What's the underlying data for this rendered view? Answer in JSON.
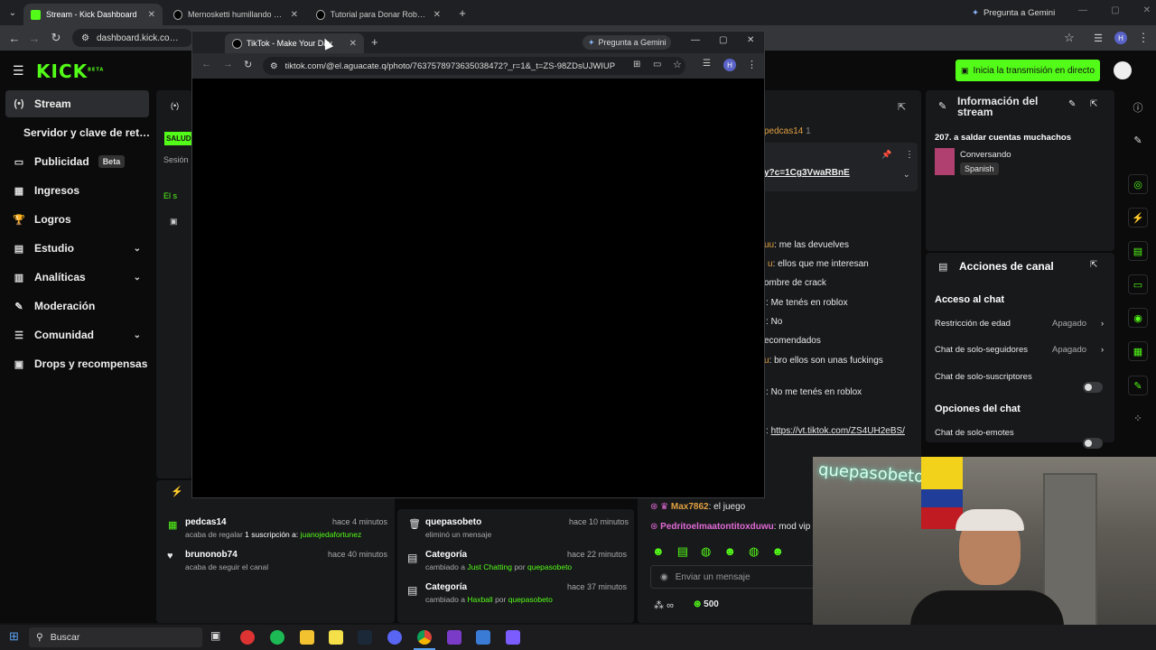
{
  "outer_tabs": [
    {
      "title": "Stream - Kick Dashboard",
      "active": true
    },
    {
      "title": "Mernosketti humillando a los T"
    },
    {
      "title": "Tutorial para Donar Robux a un"
    }
  ],
  "gemini_label": "Pregunta a Gemini",
  "outer_url": "dashboard.kick.com/strea",
  "profile_initial": "H",
  "kick": {
    "logo": "KICK",
    "logo_beta": "BETA",
    "go_live": "Inicia la transmisión en directo",
    "sidebar": [
      {
        "label": "Stream",
        "icon": "(•)"
      },
      {
        "label": "Servidor y clave de retransmisión",
        "icon": ""
      },
      {
        "label": "Publicidad",
        "icon": "▭",
        "badge": "Beta"
      },
      {
        "label": "Ingresos",
        "icon": "▦"
      },
      {
        "label": "Logros",
        "icon": "🏆"
      },
      {
        "label": "Estudio",
        "icon": "▤",
        "chev": "⌄"
      },
      {
        "label": "Analíticas",
        "icon": "▥",
        "chev": "⌄"
      },
      {
        "label": "Moderación",
        "icon": "✎"
      },
      {
        "label": "Comunidad",
        "icon": "☰",
        "chev": "⌄"
      },
      {
        "label": "Drops y recompensas",
        "icon": "▣"
      }
    ],
    "center": {
      "badge": "SALUD",
      "session": "Sesión",
      "status": "El s"
    },
    "chat": {
      "pinned_user": "pedcas14",
      "pinned_count": "1",
      "pinned_link": "y?c=1Cg3VwaRBnE",
      "lines": [
        {
          "user": "uu",
          "text": "me las devuelves"
        },
        {
          "user": "u",
          "text": "ellos que me interesan"
        },
        {
          "user": "",
          "text": "ombre de crack"
        },
        {
          "user": "",
          "text": "Me tenés en roblox"
        },
        {
          "user": "",
          "text": "No"
        },
        {
          "user": "",
          "text": "ecomendados"
        },
        {
          "user": "u",
          "text": "bro ellos son unas fuckings"
        },
        {
          "user": "",
          "text": "No me tenés en roblox"
        },
        {
          "user": "",
          "text": "https://vt.tiktok.com/ZS4UH2eBS/"
        }
      ],
      "bottom_lines": [
        {
          "user": "Max7862",
          "text": "el juego"
        },
        {
          "user": "Pedritoelmaatontitoxduwu",
          "text": "mod vip y"
        }
      ],
      "input_placeholder": "Enviar un mensaje",
      "infinity": "∞",
      "points": "500"
    },
    "stream_info": {
      "title": "Información del stream",
      "stream_title": "207. a saldar cuentas muchachos",
      "category": "Conversando",
      "language": "Spanish"
    },
    "channel_actions": {
      "title": "Acciones de canal",
      "chat_access": "Acceso al chat",
      "rows": [
        {
          "label": "Restricción de edad",
          "value": "Apagado"
        },
        {
          "label": "Chat de solo-seguidores",
          "value": "Apagado"
        },
        {
          "label": "Chat de solo-suscriptores",
          "value": ""
        }
      ],
      "chat_options": "Opciones del chat",
      "emotes_only": "Chat de solo-emotes"
    },
    "activity_left": [
      {
        "user": "pedcas14",
        "time": "hace 4 minutos",
        "desc": "acaba de regalar",
        "desc2": "1 suscripción a:",
        "target": "juanojedafortunez"
      },
      {
        "user": "brunonob74",
        "time": "hace 40 minutos",
        "desc": "acaba de seguir el canal"
      }
    ],
    "activity_right": [
      {
        "user": "quepasobeto",
        "time": "hace 10 minutos",
        "desc": "eliminó un mensaje"
      },
      {
        "user": "Categoría",
        "time": "hace 22 minutos",
        "desc": "cambiado a",
        "cat": "Just Chatting",
        "by": "por",
        "target": "quepasobeto"
      },
      {
        "user": "Categoría",
        "time": "hace 37 minutos",
        "desc": "cambiado a",
        "cat": "Haxball",
        "by": "por",
        "target": "quepasobeto"
      }
    ]
  },
  "inner": {
    "tab_title": "TikTok - Make Your Day",
    "gemini": "Pregunta a Gemini",
    "url": "tiktok.com/@el.aguacate.q/photo/7637578973635038472?_r=1&_t=ZS-98ZDsUJWIUP",
    "profile": "H"
  },
  "taskbar": {
    "search": "Buscar"
  },
  "cam": {
    "neon": "quepasobeto"
  }
}
